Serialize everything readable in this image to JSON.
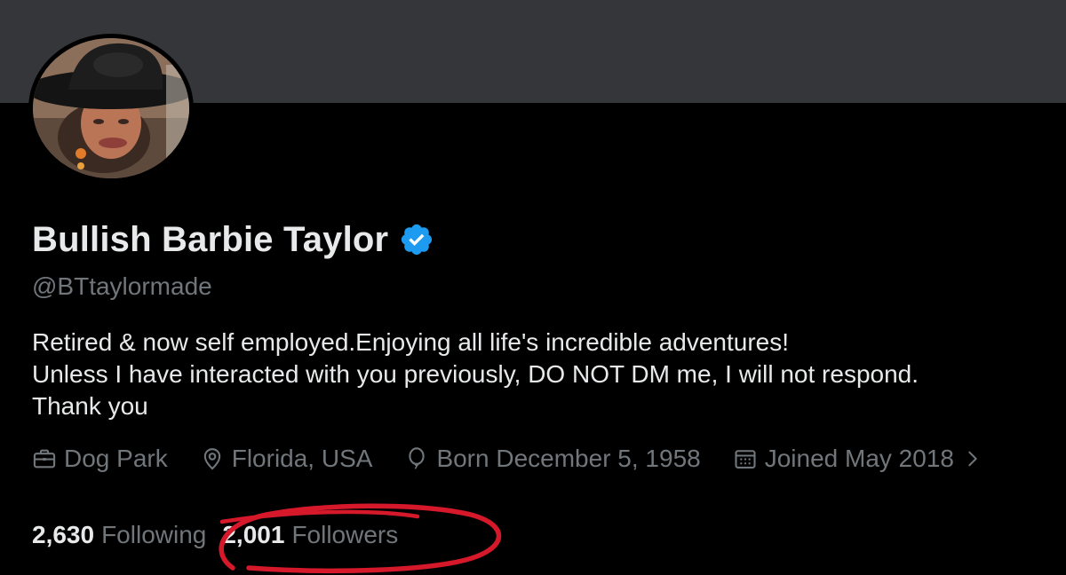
{
  "profile": {
    "display_name": "Bullish Barbie Taylor",
    "handle": "@BTtaylormade",
    "verified": true,
    "bio": [
      "Retired & now self employed.Enjoying all life's incredible adventures!",
      "Unless I have interacted with you previously, DO NOT DM me, I will not respond.",
      "Thank you"
    ],
    "meta": {
      "work": "Dog Park",
      "location": "Florida, USA",
      "birthday": "Born December 5, 1958",
      "joined": "Joined May 2018"
    },
    "stats": {
      "following_count": "2,630",
      "following_label": "Following",
      "followers_count": "2,001",
      "followers_label": "Followers"
    }
  },
  "icons": {
    "verified": "verified-badge-icon",
    "work": "briefcase-icon",
    "location": "map-pin-icon",
    "birthday": "balloon-icon",
    "joined": "calendar-icon",
    "more": "chevron-right-icon"
  },
  "colors": {
    "background": "#000000",
    "banner": "#34363a",
    "primary_text": "#e7e9ea",
    "secondary_text": "#71767b",
    "verified_blue": "#1d9bf0",
    "annotation_red": "#d6182b"
  }
}
